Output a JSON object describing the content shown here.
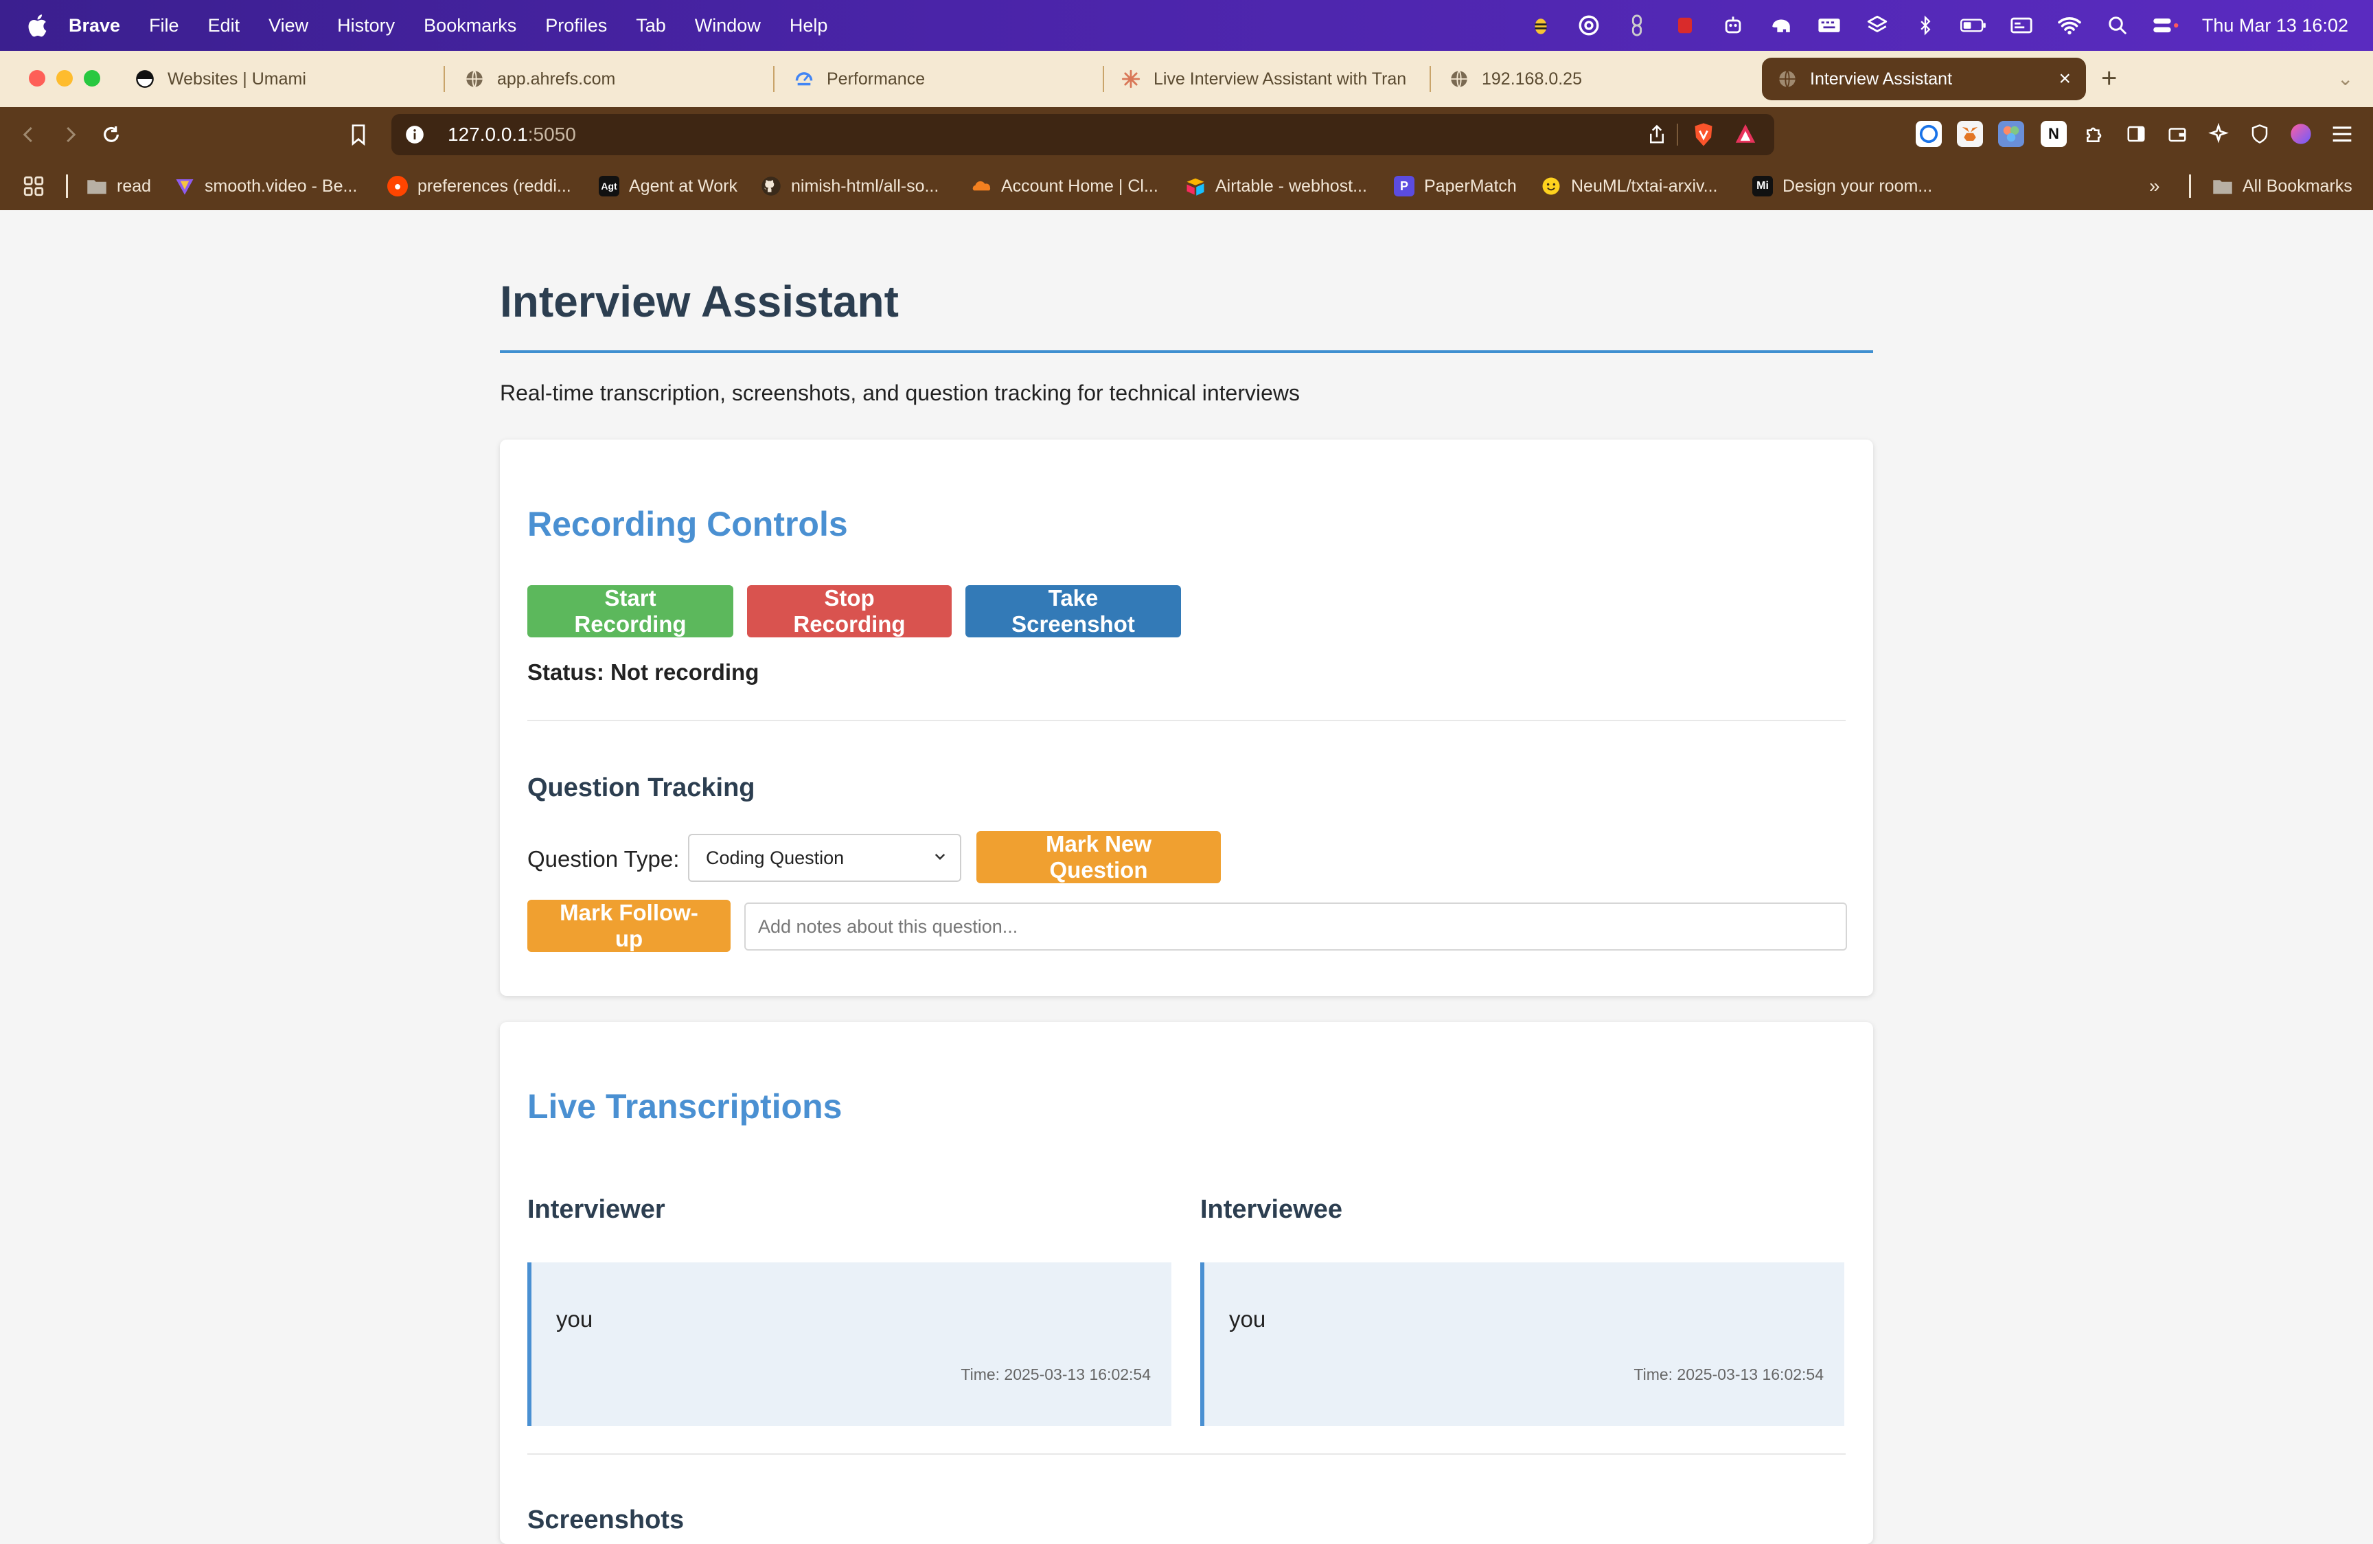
{
  "menubar": {
    "app": "Brave",
    "items": [
      "File",
      "Edit",
      "View",
      "History",
      "Bookmarks",
      "Profiles",
      "Tab",
      "Window",
      "Help"
    ],
    "clock": "Thu Mar 13  16:02"
  },
  "tabs": [
    {
      "title": "Websites | Umami",
      "icon": "umami-icon"
    },
    {
      "title": "app.ahrefs.com",
      "icon": "globe-icon"
    },
    {
      "title": "Performance",
      "icon": "performance-icon"
    },
    {
      "title": "Live Interview Assistant with Tran",
      "icon": "claude-icon"
    },
    {
      "title": "192.168.0.25",
      "icon": "globe-icon"
    },
    {
      "title": "Interview Assistant",
      "icon": "globe-icon",
      "active": true
    }
  ],
  "address": {
    "host": "127.0.0.1",
    "port": ":5050"
  },
  "bookmarks": [
    {
      "label": "read",
      "icon": "folder-icon"
    },
    {
      "label": "smooth.video - Be...",
      "icon": "smooth-video-icon"
    },
    {
      "label": "preferences (reddi...",
      "icon": "reddit-icon"
    },
    {
      "label": "Agent at Work",
      "icon": "agent-icon"
    },
    {
      "label": "nimish-html/all-so...",
      "icon": "github-icon"
    },
    {
      "label": "Account Home | Cl...",
      "icon": "cloudflare-icon"
    },
    {
      "label": "Airtable - webhost...",
      "icon": "airtable-icon"
    },
    {
      "label": "PaperMatch",
      "icon": "papermatch-icon"
    },
    {
      "label": "NeuML/txtai-arxiv...",
      "icon": "huggingface-icon"
    },
    {
      "label": "Design your room...",
      "icon": "design-icon"
    },
    {
      "label": "All Bookmarks",
      "icon": "folder-icon"
    }
  ],
  "page": {
    "title": "Interview Assistant",
    "subtitle": "Real-time transcription, screenshots, and question tracking for technical interviews"
  },
  "recording": {
    "heading": "Recording Controls",
    "start_label": "Start Recording",
    "stop_label": "Stop Recording",
    "screenshot_label": "Take Screenshot",
    "status": "Status: Not recording"
  },
  "questions": {
    "heading": "Question Tracking",
    "type_label": "Question Type:",
    "type_value": "Coding Question",
    "mark_new_label": "Mark New Question",
    "mark_followup_label": "Mark Follow-up",
    "notes_placeholder": "Add notes about this question..."
  },
  "transcriptions": {
    "heading": "Live Transcriptions",
    "interviewer": {
      "title": "Interviewer",
      "text": "you",
      "time": "Time: 2025-03-13 16:02:54"
    },
    "interviewee": {
      "title": "Interviewee",
      "text": "you",
      "time": "Time: 2025-03-13 16:02:54"
    },
    "screenshots_heading": "Screenshots"
  },
  "colors": {
    "accent": "#4a90d2",
    "start": "#5cb85c",
    "stop": "#d9534f",
    "screenshot": "#337ab7",
    "mark": "#f0a030"
  }
}
